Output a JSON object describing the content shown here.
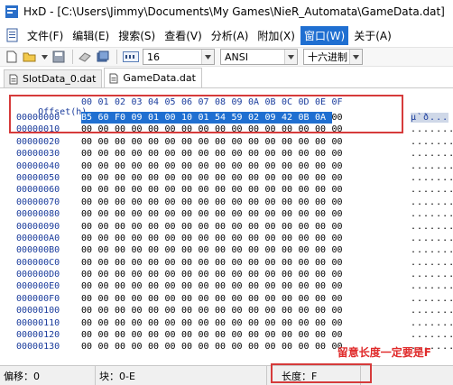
{
  "window": {
    "title": "HxD - [C:\\Users\\Jimmy\\Documents\\My Games\\NieR_Automata\\GameData.dat]"
  },
  "menu": {
    "items": [
      {
        "label": "文件(F)",
        "active": false
      },
      {
        "label": "编辑(E)",
        "active": false
      },
      {
        "label": "搜索(S)",
        "active": false
      },
      {
        "label": "查看(V)",
        "active": false
      },
      {
        "label": "分析(A)",
        "active": false
      },
      {
        "label": "附加(X)",
        "active": false
      },
      {
        "label": "窗口(W)",
        "active": true
      },
      {
        "label": "关于(A)",
        "active": false
      }
    ]
  },
  "toolbar": {
    "bytes_per_row": "16",
    "charset": "ANSI",
    "offset_base": "十六进制"
  },
  "tabs": [
    {
      "label": "SlotData_0.dat",
      "active": false
    },
    {
      "label": "GameData.dat",
      "active": true
    }
  ],
  "hex": {
    "header_label": "Offset(h)",
    "columns": [
      "00",
      "01",
      "02",
      "03",
      "04",
      "05",
      "06",
      "07",
      "08",
      "09",
      "0A",
      "0B",
      "0C",
      "0D",
      "0E",
      "0F"
    ],
    "rows": [
      {
        "offset": "00000000",
        "bytes": [
          "B5",
          "60",
          "F0",
          "09",
          "01",
          "00",
          "10",
          "01",
          "54",
          "59",
          "02",
          "09",
          "42",
          "0B",
          "0A",
          "00"
        ],
        "ascii": "µ`ð..."
      },
      {
        "offset": "00000010",
        "bytes": [
          "00",
          "00",
          "00",
          "00",
          "00",
          "00",
          "00",
          "00",
          "00",
          "00",
          "00",
          "00",
          "00",
          "00",
          "00",
          "00"
        ],
        "ascii": "........"
      },
      {
        "offset": "00000020",
        "bytes": [
          "00",
          "00",
          "00",
          "00",
          "00",
          "00",
          "00",
          "00",
          "00",
          "00",
          "00",
          "00",
          "00",
          "00",
          "00",
          "00"
        ],
        "ascii": "........"
      },
      {
        "offset": "00000030",
        "bytes": [
          "00",
          "00",
          "00",
          "00",
          "00",
          "00",
          "00",
          "00",
          "00",
          "00",
          "00",
          "00",
          "00",
          "00",
          "00",
          "00"
        ],
        "ascii": "........"
      },
      {
        "offset": "00000040",
        "bytes": [
          "00",
          "00",
          "00",
          "00",
          "00",
          "00",
          "00",
          "00",
          "00",
          "00",
          "00",
          "00",
          "00",
          "00",
          "00",
          "00"
        ],
        "ascii": "........"
      },
      {
        "offset": "00000050",
        "bytes": [
          "00",
          "00",
          "00",
          "00",
          "00",
          "00",
          "00",
          "00",
          "00",
          "00",
          "00",
          "00",
          "00",
          "00",
          "00",
          "00"
        ],
        "ascii": "........"
      },
      {
        "offset": "00000060",
        "bytes": [
          "00",
          "00",
          "00",
          "00",
          "00",
          "00",
          "00",
          "00",
          "00",
          "00",
          "00",
          "00",
          "00",
          "00",
          "00",
          "00"
        ],
        "ascii": "........"
      },
      {
        "offset": "00000070",
        "bytes": [
          "00",
          "00",
          "00",
          "00",
          "00",
          "00",
          "00",
          "00",
          "00",
          "00",
          "00",
          "00",
          "00",
          "00",
          "00",
          "00"
        ],
        "ascii": "........"
      },
      {
        "offset": "00000080",
        "bytes": [
          "00",
          "00",
          "00",
          "00",
          "00",
          "00",
          "00",
          "00",
          "00",
          "00",
          "00",
          "00",
          "00",
          "00",
          "00",
          "00"
        ],
        "ascii": "........"
      },
      {
        "offset": "00000090",
        "bytes": [
          "00",
          "00",
          "00",
          "00",
          "00",
          "00",
          "00",
          "00",
          "00",
          "00",
          "00",
          "00",
          "00",
          "00",
          "00",
          "00"
        ],
        "ascii": "........"
      },
      {
        "offset": "000000A0",
        "bytes": [
          "00",
          "00",
          "00",
          "00",
          "00",
          "00",
          "00",
          "00",
          "00",
          "00",
          "00",
          "00",
          "00",
          "00",
          "00",
          "00"
        ],
        "ascii": "........"
      },
      {
        "offset": "000000B0",
        "bytes": [
          "00",
          "00",
          "00",
          "00",
          "00",
          "00",
          "00",
          "00",
          "00",
          "00",
          "00",
          "00",
          "00",
          "00",
          "00",
          "00"
        ],
        "ascii": "........"
      },
      {
        "offset": "000000C0",
        "bytes": [
          "00",
          "00",
          "00",
          "00",
          "00",
          "00",
          "00",
          "00",
          "00",
          "00",
          "00",
          "00",
          "00",
          "00",
          "00",
          "00"
        ],
        "ascii": "........"
      },
      {
        "offset": "000000D0",
        "bytes": [
          "00",
          "00",
          "00",
          "00",
          "00",
          "00",
          "00",
          "00",
          "00",
          "00",
          "00",
          "00",
          "00",
          "00",
          "00",
          "00"
        ],
        "ascii": "........"
      },
      {
        "offset": "000000E0",
        "bytes": [
          "00",
          "00",
          "00",
          "00",
          "00",
          "00",
          "00",
          "00",
          "00",
          "00",
          "00",
          "00",
          "00",
          "00",
          "00",
          "00"
        ],
        "ascii": "........"
      },
      {
        "offset": "000000F0",
        "bytes": [
          "00",
          "00",
          "00",
          "00",
          "00",
          "00",
          "00",
          "00",
          "00",
          "00",
          "00",
          "00",
          "00",
          "00",
          "00",
          "00"
        ],
        "ascii": "........"
      },
      {
        "offset": "00000100",
        "bytes": [
          "00",
          "00",
          "00",
          "00",
          "00",
          "00",
          "00",
          "00",
          "00",
          "00",
          "00",
          "00",
          "00",
          "00",
          "00",
          "00"
        ],
        "ascii": "........"
      },
      {
        "offset": "00000110",
        "bytes": [
          "00",
          "00",
          "00",
          "00",
          "00",
          "00",
          "00",
          "00",
          "00",
          "00",
          "00",
          "00",
          "00",
          "00",
          "00",
          "00"
        ],
        "ascii": "........"
      },
      {
        "offset": "00000120",
        "bytes": [
          "00",
          "00",
          "00",
          "00",
          "00",
          "00",
          "00",
          "00",
          "00",
          "00",
          "00",
          "00",
          "00",
          "00",
          "00",
          "00"
        ],
        "ascii": "........"
      },
      {
        "offset": "00000130",
        "bytes": [
          "00",
          "00",
          "00",
          "00",
          "00",
          "00",
          "00",
          "00",
          "00",
          "00",
          "00",
          "00",
          "00",
          "00",
          "00",
          "00"
        ],
        "ascii": "........"
      }
    ],
    "selection": {
      "row": 0,
      "start": 0,
      "end": 14
    }
  },
  "annotation": {
    "text": "留意长度一定要是F",
    "color": "#e02b2b"
  },
  "status": {
    "offset": "偏移：0",
    "block": "块：0-E",
    "length": "长度：F",
    "extra": ""
  },
  "colors": {
    "selection": "#1f6fd1",
    "highlight_box": "#d63b3b",
    "offset_text": "#1a3c9c"
  }
}
